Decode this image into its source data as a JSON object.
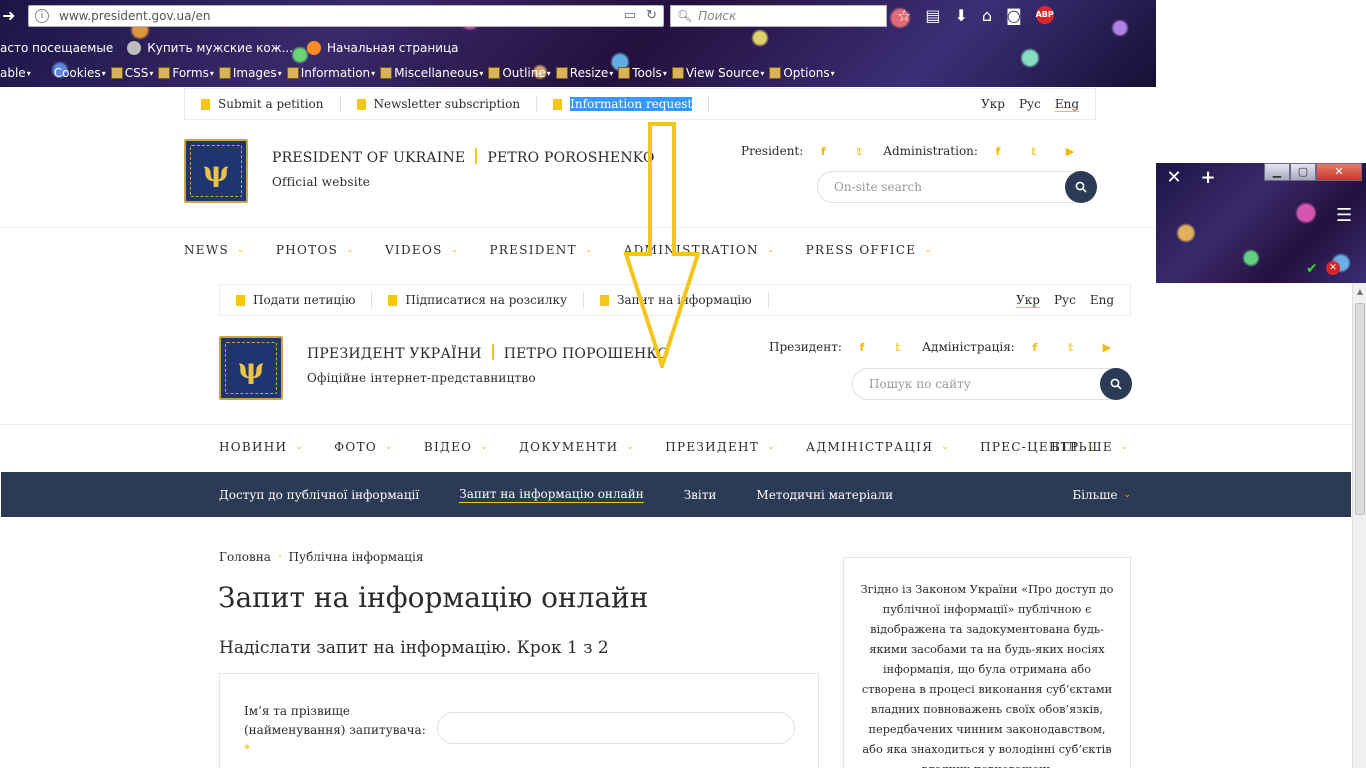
{
  "browser": {
    "url": "www.president.gov.ua/en",
    "search_placeholder": "Поиск",
    "bookmarks": [
      {
        "label": "асто посещаемые",
        "color": "#7aa2ff"
      },
      {
        "label": "Купить мужские кож...",
        "color": "#c9c9c9"
      },
      {
        "label": "Начальная страница",
        "color": "#ff8a2a"
      }
    ],
    "webdev": [
      "able",
      "Cookies",
      "CSS",
      "Forms",
      "Images",
      "Information",
      "Miscellaneous",
      "Outline",
      "Resize",
      "Tools",
      "View Source",
      "Options"
    ]
  },
  "page_en": {
    "top_links": [
      "Submit a petition",
      "Newsletter subscription",
      "Information request"
    ],
    "languages": [
      "Укр",
      "Рус",
      "Eng"
    ],
    "active_language": "Eng",
    "brand_title": "PRESIDENT OF UKRAINE",
    "brand_name": "PETRO POROSHENKO",
    "brand_sub": "Official website",
    "president_label": "President:",
    "admin_label": "Administration:",
    "search_placeholder": "On-site search",
    "menu": [
      "NEWS",
      "PHOTOS",
      "VIDEOS",
      "PRESIDENT",
      "ADMINISTRATION",
      "PRESS OFFICE"
    ]
  },
  "page_ua": {
    "top_links": [
      "Подати петицію",
      "Підписатися на розсилку",
      "Запит на інформацію"
    ],
    "languages": [
      "Укр",
      "Рус",
      "Eng"
    ],
    "active_language": "Укр",
    "brand_title": "ПРЕЗИДЕНТ УКРАЇНИ",
    "brand_name": "ПЕТРО ПОРОШЕНКО",
    "brand_sub": "Офіційне інтернет-представництво",
    "president_label": "Президент:",
    "admin_label": "Адміністрація:",
    "search_placeholder": "Пошук по сайту",
    "menu": [
      "НОВИНИ",
      "ФОТО",
      "ВІДЕО",
      "ДОКУМЕНТИ",
      "ПРЕЗИДЕНТ",
      "АДМІНІСТРАЦІЯ",
      "ПРЕС-ЦЕНТР"
    ],
    "menu_more": "БІЛЬШЕ",
    "subnav": [
      "Доступ до публічної інформації",
      "Запит на інформацію онлайн",
      "Звіти",
      "Методичні матеріали"
    ],
    "subnav_more": "Більше",
    "breadcrumb": [
      "Головна",
      "Публічна інформація"
    ],
    "heading": "Запит на інформацію онлайн",
    "step_heading": "Надіслати запит на інформацію. Крок 1 з 2",
    "form_label": "Ім’я та прізвище (найменування) запитувача:",
    "required_mark": "*",
    "sidebar_text": "Згідно із Законом України «Про доступ до публічної інформації» публічною є відображена та задокументована будь-якими засобами та на будь-яких носіях інформація, що була отримана або створена в процесі виконання суб’єктами владних повноважень своїх обов’язків, передбачених чинним законодавством, або яка знаходиться у володінні суб’єктів владних повноважень"
  },
  "colors": {
    "accent": "#f5c518",
    "navy": "#2b3a55",
    "arrow": "#f5c518"
  },
  "icons": [
    "info-icon",
    "reader-icon",
    "reload-icon",
    "search-icon",
    "star-icon",
    "bookmark-icon",
    "download-icon",
    "home-icon",
    "pocket-icon",
    "adblock-icon",
    "facebook-icon",
    "twitter-icon",
    "youtube-icon",
    "close-icon",
    "menu-icon"
  ]
}
